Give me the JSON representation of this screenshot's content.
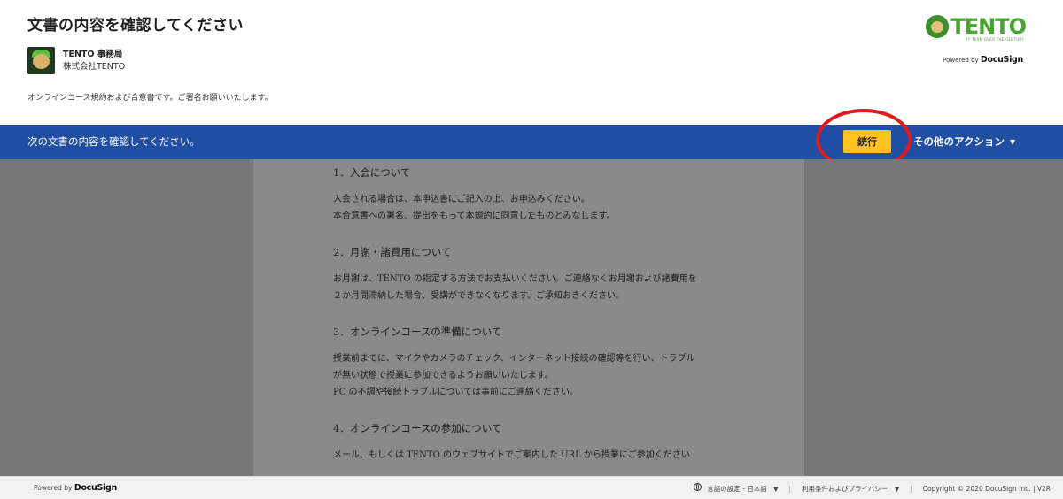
{
  "header": {
    "title": "文書の内容を確認してください",
    "sender_name": "TENTO 事務局",
    "sender_company": "株式会社TENTO",
    "message": "オンラインコース規約および合意書です。ご署名お願いいたします。",
    "logo_text": "TENTO",
    "logo_tagline": "IT TEAM OVER THE CENTURY",
    "powered_by": "Powered by",
    "docusign": "DocuSign"
  },
  "action_bar": {
    "instruction": "次の文書の内容を確認してください。",
    "continue_label": "続行",
    "other_actions_label": "その他のアクション",
    "accent_color": "#ffc21f",
    "bar_color": "#1f4ea3"
  },
  "document": {
    "sections": [
      {
        "heading": "1．入会について",
        "lines": [
          "入会される場合は、本申込書にご記入の上、お申込みください。",
          "本合意書への署名、提出をもって本規約に同意したものとみなします。"
        ]
      },
      {
        "heading": "2．月謝・諸費用について",
        "lines": [
          "お月謝は、TENTO の指定する方法でお支払いください。ご連絡なくお月謝および諸費用を",
          "２か月間滞納した場合、受講ができなくなります。ご承知おきください。"
        ]
      },
      {
        "heading": "3．オンラインコースの準備について",
        "lines": [
          "授業前までに、マイクやカメラのチェック、インターネット接続の確認等を行い、トラブル",
          "が無い状態で授業に参加できるようお願いいたします。",
          "PC の不調や接続トラブルについては事前にご連絡ください。"
        ]
      },
      {
        "heading": "4．オンラインコースの参加について",
        "lines": [
          "メール、もしくは TENTO のウェブサイトでご案内した URL から授業にご参加ください"
        ]
      }
    ]
  },
  "footer": {
    "powered_by": "Powered by",
    "docusign": "DocuSign",
    "language": "言語の設定 - 日本語",
    "terms": "利用条件およびプライバシー",
    "copyright": "Copyright © 2020 DocuSign Inc. | V2R"
  },
  "icons": {
    "globe": "globe-icon",
    "caret": "caret-down-icon"
  }
}
